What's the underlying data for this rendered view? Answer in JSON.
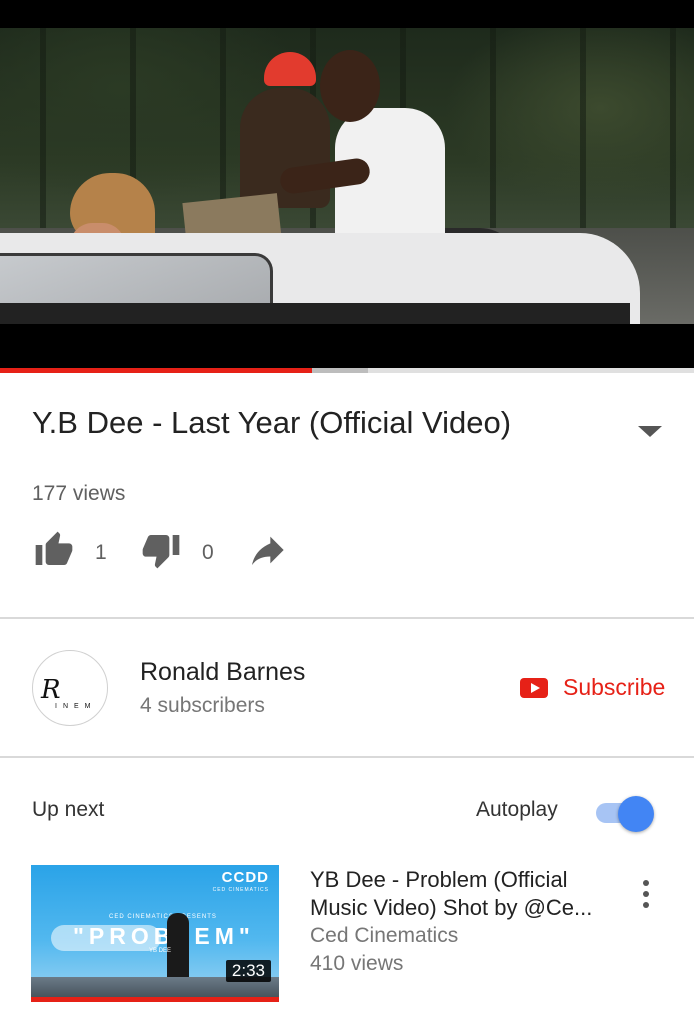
{
  "player": {
    "progress_fraction": 0.45,
    "buffered_fraction": 0.53
  },
  "video": {
    "title": "Y.B Dee - Last Year (Official Video)",
    "views": "177 views",
    "likes": "1",
    "dislikes": "0"
  },
  "channel": {
    "name": "Ronald Barnes",
    "subscribers": "4 subscribers",
    "avatar_text": "R",
    "avatar_subtext": "INEM",
    "subscribe_label": "Subscribe"
  },
  "up_next": {
    "label": "Up next",
    "autoplay_label": "Autoplay",
    "autoplay_on": true,
    "items": [
      {
        "title": "YB Dee - Problem (Official Music Video) Shot by @Ce...",
        "channel": "Ced Cinematics",
        "views": "410 views",
        "duration": "2:33",
        "thumb_brand": "CCDD",
        "thumb_brand_sub": "CED CINEMATICS",
        "thumb_presents": "CED CINEMATICS PRESENTS",
        "thumb_word": "\"PROBLEM\"",
        "thumb_artist": "YB DEE"
      }
    ]
  },
  "colors": {
    "accent_red": "#e62117",
    "toggle_blue": "#4285f4"
  },
  "icons": [
    "thumb-up-icon",
    "thumb-down-icon",
    "share-icon",
    "chevron-down-icon",
    "youtube-logo-icon",
    "more-vert-icon"
  ]
}
